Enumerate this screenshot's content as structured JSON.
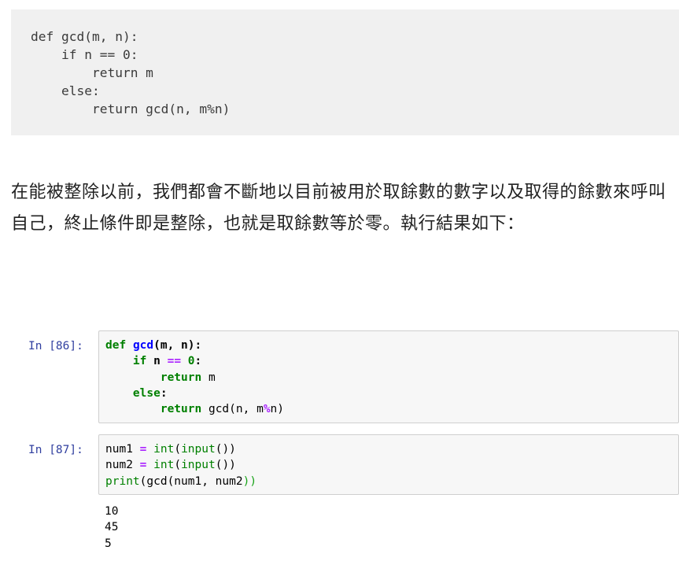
{
  "code_block": {
    "lines": [
      "def gcd(m, n):",
      "    if n == 0:",
      "        return m",
      "    else:",
      "        return gcd(n, m%n)"
    ]
  },
  "prose": {
    "text": "在能被整除以前，我們都會不斷地以目前被用於取餘數的數字以及取得的餘數來呼叫自己，終止條件即是整除，也就是取餘數等於零。執行結果如下："
  },
  "notebook": {
    "cell1": {
      "prompt": "In [86]:",
      "tokens": {
        "def": "def",
        "gcd_name": "gcd",
        "sig": "(m, n):",
        "if": "if",
        "n_eq": " n ",
        "eq": "==",
        "zero": "0",
        "colon": ":",
        "return1": "return",
        "m": " m",
        "else": "else",
        "colon2": ":",
        "return2": "return",
        "call": " gcd(n, m",
        "mod": "%",
        "end": "n)"
      }
    },
    "cell2": {
      "prompt": "In [87]:",
      "tokens": {
        "num1": "num1",
        "assign1": "=",
        "int1": "int",
        "input1": "input",
        "rest1": "())",
        "num2": "num2",
        "assign2": "=",
        "int2": "int",
        "input2": "input",
        "rest2": "())",
        "print": "print",
        "args": "(gcd(num1, num2",
        "close": "))"
      },
      "output": [
        "10",
        "45",
        "5"
      ]
    }
  },
  "colors": {
    "prompt": "#303f9f",
    "keyword": "#008000",
    "function_name": "#0000ff",
    "operator": "#aa22ff",
    "cell_bg": "#f7f7f7",
    "code_block_bg": "#f0f0f0"
  }
}
